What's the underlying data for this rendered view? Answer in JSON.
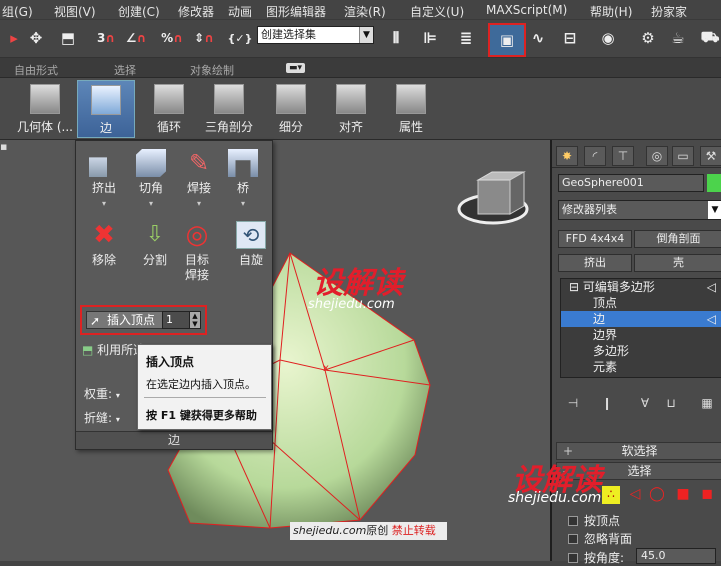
{
  "menu": [
    "组(G)",
    "视图(V)",
    "创建(C)",
    "修改器",
    "动画",
    "图形编辑器",
    "渲染(R)",
    "自定义(U)",
    "MAXScript(M)",
    "帮助(H)",
    "扮家家"
  ],
  "toolbar": {
    "selection_set": "创建选择集"
  },
  "ribbon_tabs": [
    "自由形式",
    "选择",
    "对象绘制"
  ],
  "ribbon_buttons": [
    "几何体 (...",
    "边",
    "循环",
    "三角剖分",
    "细分",
    "对齐",
    "属性"
  ],
  "edge_panel": {
    "tools_row1": [
      "挤出",
      "切角",
      "焊接",
      "桥"
    ],
    "tools_row2": [
      "移除",
      "分割",
      "目标焊接",
      "自旋"
    ],
    "insert_vertex_label": "插入顶点",
    "insert_vertex_value": "1",
    "use_selection_text": "利用所选",
    "weight_label": "权重:",
    "crease_label": "折缝:",
    "footer": "边"
  },
  "tooltip": {
    "title": "插入顶点",
    "desc": "在选定边内插入顶点。",
    "help_prefix": "按",
    "help_key": "F1",
    "help_suffix": "键获得更多帮助"
  },
  "command_panel": {
    "object_name": "GeoSphere001",
    "modifier_list": "修改器列表",
    "btn_ffd": "FFD 4x4x4",
    "btn_chamfer_profile": "倒角剖面",
    "btn_extrude": "挤出",
    "btn_shell": "壳",
    "stack": {
      "root": "可编辑多边形",
      "items": [
        "顶点",
        "边",
        "边界",
        "多边形",
        "元素"
      ],
      "selected": "边"
    },
    "soft_selection": "软选择",
    "selection": "选择",
    "by_vertex": "按顶点",
    "ignore_backfacing": "忽略背面",
    "by_angle": "按角度:",
    "angle_value": "45.0"
  },
  "colors": {
    "accent": "#3a7bd0",
    "highlight_border": "#dd2222",
    "object_color": "#4cd34c"
  },
  "watermarks": {
    "brand": "设解读",
    "url": "shejiedu.com",
    "footer_site": "shejiedu.com",
    "footer_original": "原创",
    "footer_notice": "禁止转载"
  }
}
